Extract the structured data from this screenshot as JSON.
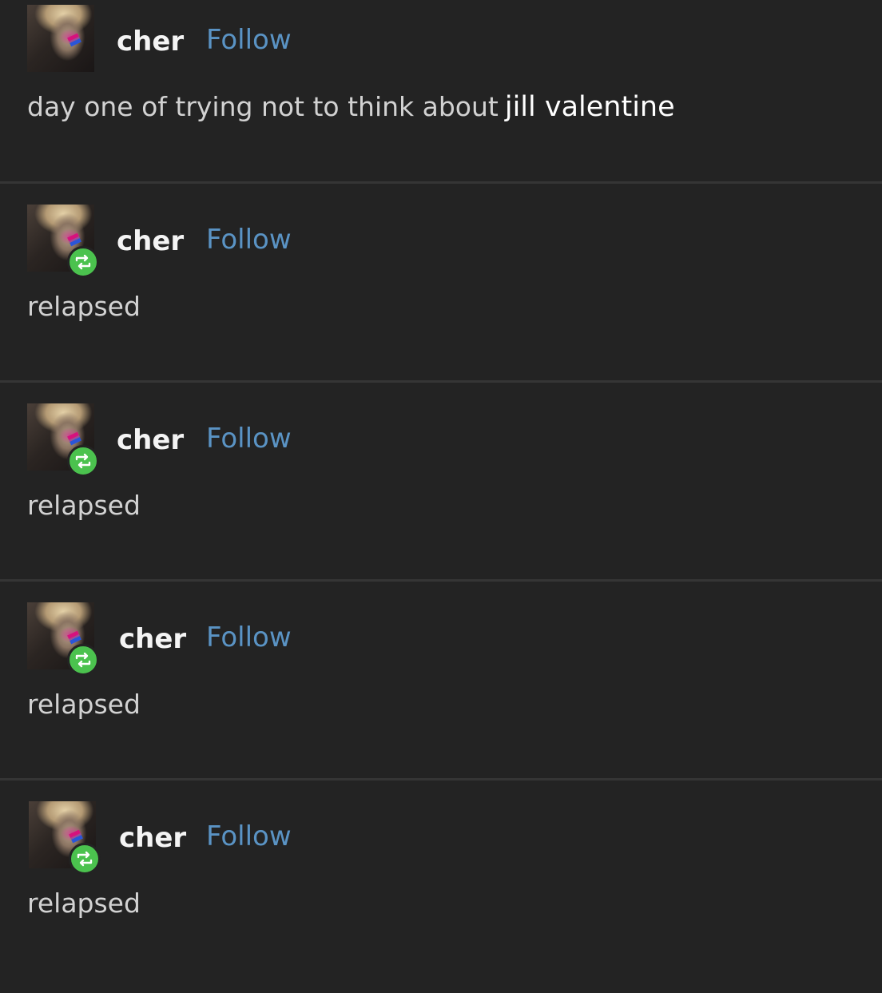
{
  "posts": [
    {
      "username": "cher",
      "follow_label": "Follow",
      "text": "day one of trying not to think about",
      "text_highlight": "jill valentine",
      "reblog": false
    },
    {
      "username": "cher",
      "follow_label": "Follow",
      "text": "relapsed",
      "reblog": true
    },
    {
      "username": "cher",
      "follow_label": "Follow",
      "text": "relapsed",
      "reblog": true
    },
    {
      "username": "cher",
      "follow_label": "Follow",
      "text": "relapsed",
      "reblog": true
    },
    {
      "username": "cher",
      "follow_label": "Follow",
      "text": "relapsed",
      "reblog": true
    }
  ],
  "colors": {
    "background": "#232323",
    "divider": "#353535",
    "follow": "#5a93c4",
    "username": "#f4f4f4",
    "reblog_badge": "#4bc24e"
  },
  "icons": {
    "avatar": "avatar-image",
    "reblog": "reblog-icon"
  }
}
